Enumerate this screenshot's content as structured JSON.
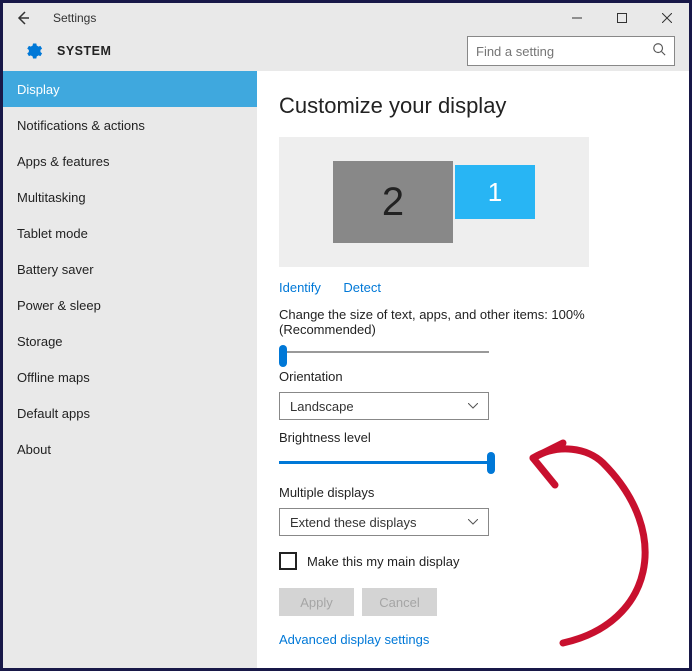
{
  "window": {
    "title": "Settings",
    "breadcrumb": "SYSTEM",
    "search_placeholder": "Find a setting"
  },
  "sidebar": {
    "items": [
      {
        "label": "Display",
        "selected": true
      },
      {
        "label": "Notifications & actions",
        "selected": false
      },
      {
        "label": "Apps & features",
        "selected": false
      },
      {
        "label": "Multitasking",
        "selected": false
      },
      {
        "label": "Tablet mode",
        "selected": false
      },
      {
        "label": "Battery saver",
        "selected": false
      },
      {
        "label": "Power & sleep",
        "selected": false
      },
      {
        "label": "Storage",
        "selected": false
      },
      {
        "label": "Offline maps",
        "selected": false
      },
      {
        "label": "Default apps",
        "selected": false
      },
      {
        "label": "About",
        "selected": false
      }
    ]
  },
  "main": {
    "heading": "Customize your display",
    "monitors": {
      "m1": "1",
      "m2": "2"
    },
    "identify": "Identify",
    "detect": "Detect",
    "scale_label": "Change the size of text, apps, and other items: 100% (Recommended)",
    "scale_value_percent": 0,
    "orientation_label": "Orientation",
    "orientation_value": "Landscape",
    "brightness_label": "Brightness level",
    "brightness_value_percent": 100,
    "multiple_label": "Multiple displays",
    "multiple_value": "Extend these displays",
    "main_display_check": "Make this my main display",
    "apply": "Apply",
    "cancel": "Cancel",
    "advanced": "Advanced display settings"
  }
}
